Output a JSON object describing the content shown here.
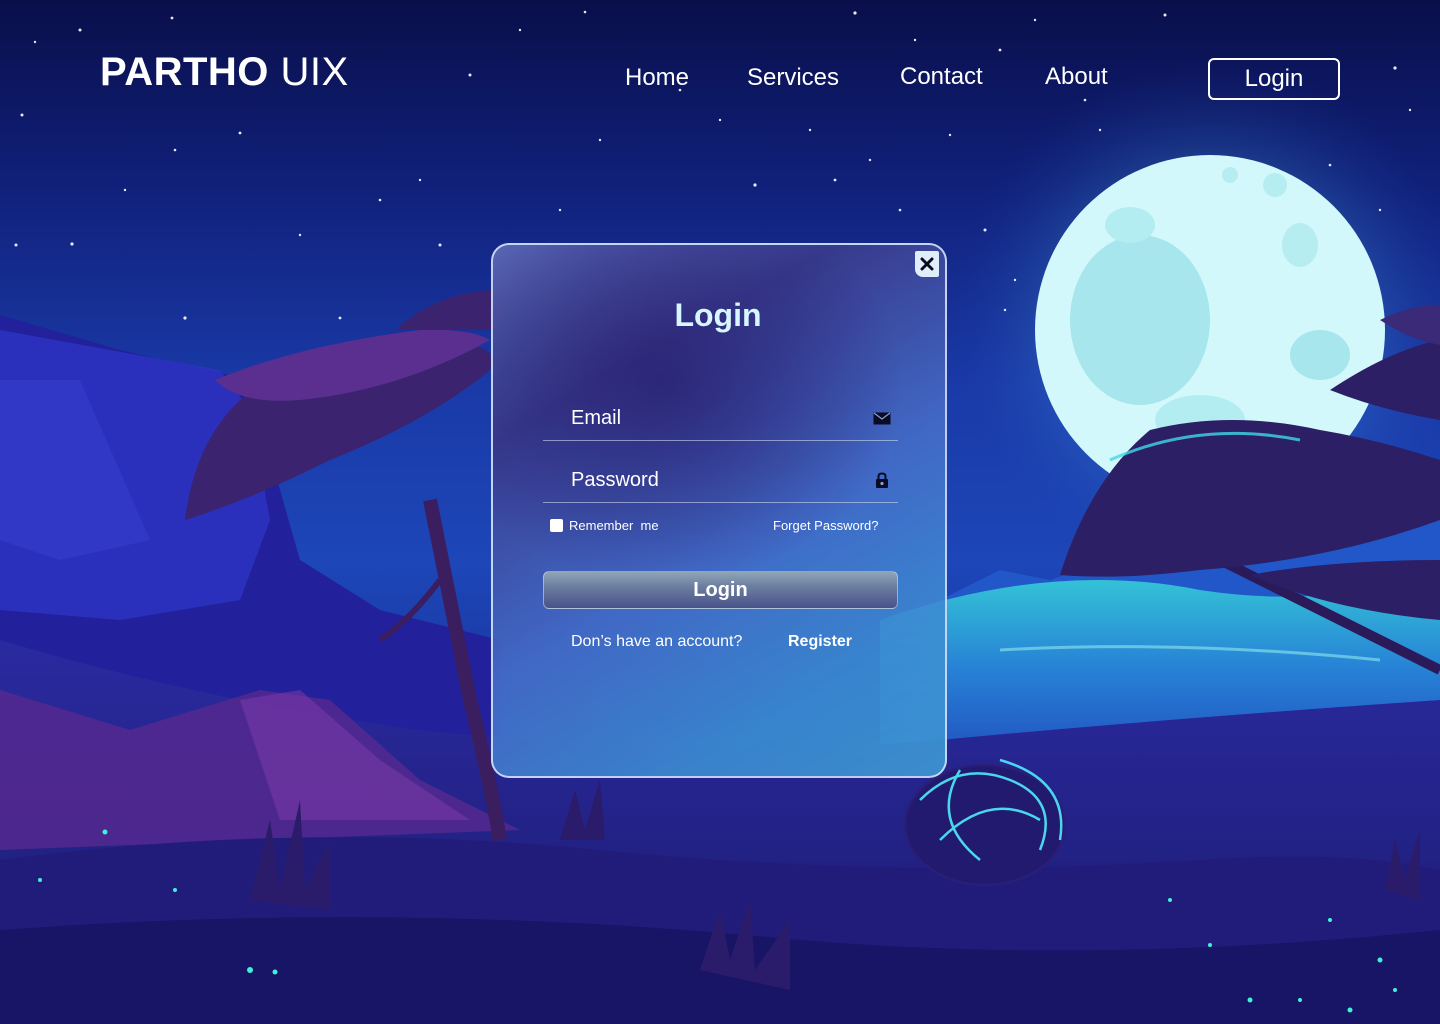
{
  "header": {
    "brand_strong": "PARTHO",
    "brand_light": "UIX",
    "nav": {
      "home": "Home",
      "services": "Services",
      "contact": "Contact",
      "about": "About"
    },
    "login_button": "Login"
  },
  "modal": {
    "title": "Login",
    "close_icon": "close-icon",
    "email": {
      "placeholder": "Email",
      "value": "",
      "icon": "envelope-icon"
    },
    "password": {
      "placeholder": "Password",
      "value": "",
      "icon": "lock-icon"
    },
    "remember_label": "Remember  me",
    "remember_checked": false,
    "forget_link": "Forget Password?",
    "submit_label": "Login",
    "signup_prompt": "Don’s have an account?",
    "register_link": "Register"
  },
  "colors": {
    "sky_top": "#0a0f4a",
    "moon": "#d2f8fb",
    "title_text": "#d7f6ff",
    "accent_teal": "#2fd3d0"
  }
}
